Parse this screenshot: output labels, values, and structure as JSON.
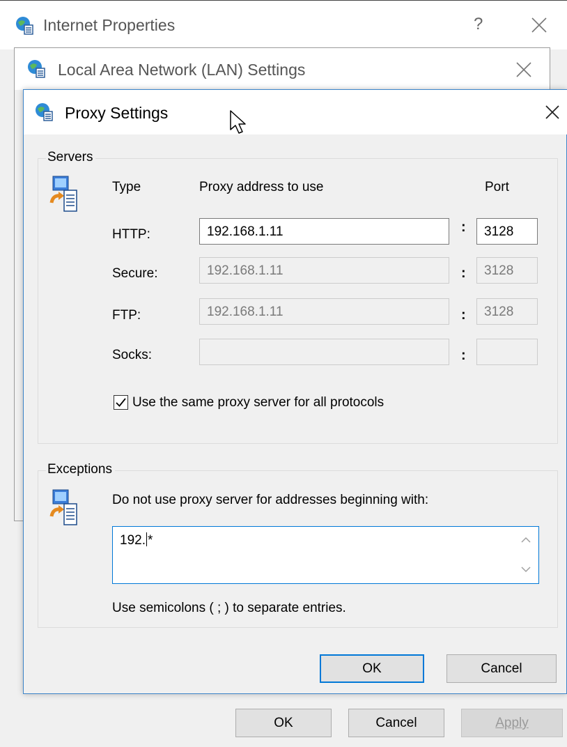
{
  "internet_properties": {
    "title": "Internet Properties",
    "help_label": "?",
    "buttons": {
      "ok": "OK",
      "cancel": "Cancel",
      "apply": "Apply"
    }
  },
  "lan_settings": {
    "title": "Local Area Network (LAN) Settings"
  },
  "proxy_settings": {
    "title": "Proxy Settings",
    "servers": {
      "group_label": "Servers",
      "col_type": "Type",
      "col_address": "Proxy address to use",
      "col_port": "Port",
      "rows": [
        {
          "type": "HTTP:",
          "address": "192.168.1.11",
          "port": "3128",
          "enabled": true
        },
        {
          "type": "Secure:",
          "address": "192.168.1.11",
          "port": "3128",
          "enabled": false
        },
        {
          "type": "FTP:",
          "address": "192.168.1.11",
          "port": "3128",
          "enabled": false
        },
        {
          "type": "Socks:",
          "address": "",
          "port": "",
          "enabled": false
        }
      ],
      "colon": ":",
      "same_proxy_label": "Use the same proxy server for all protocols",
      "same_proxy_checked": true
    },
    "exceptions": {
      "group_label": "Exceptions",
      "description": "Do not use proxy server for addresses beginning with:",
      "value_before_caret": "192.",
      "value_after_caret": "*",
      "hint": "Use semicolons ( ; ) to separate entries."
    },
    "buttons": {
      "ok": "OK",
      "cancel": "Cancel"
    }
  },
  "colors": {
    "accent": "#0078d7",
    "window_bg": "#f0f0f0"
  }
}
